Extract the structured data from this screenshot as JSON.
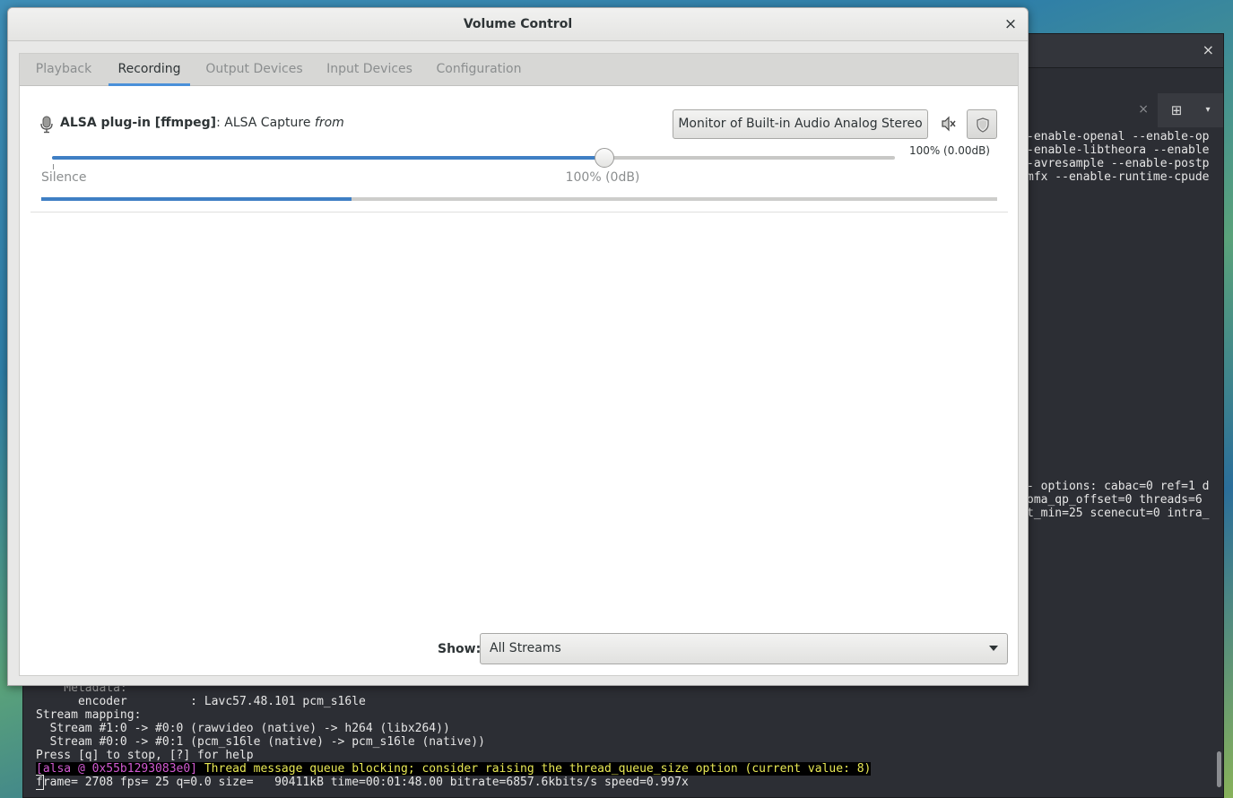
{
  "terminal": {
    "close_label": "×",
    "newtab_label": "⊞",
    "tab_close_label": "×",
    "menu_label": "▾",
    "top_lines": [
      "-enable-openal --enable-op",
      "-enable-libtheora --enable",
      "-avresample --enable-postp",
      "mfx --enable-runtime-cpude"
    ],
    "mid_lines": [
      "- options: cabac=0 ref=1 d",
      "oma_qp_offset=0 threads=6 ",
      "t_min=25 scenecut=0 intra_"
    ],
    "bottom_lines": [
      "    Metadata:",
      "      encoder         : Lavc57.48.101 pcm_s16le",
      "Stream mapping:",
      "  Stream #1:0 -> #0:0 (rawvideo (native) -> h264 (libx264))",
      "  Stream #0:0 -> #0:1 (pcm_s16le (native) -> pcm_s16le (native))",
      "Press [q] to stop, [?] for help"
    ],
    "warning_addr": "[alsa @ 0x55b1293083e0]",
    "warning_msg": " Thread message queue blocking; consider raising the thread_queue_size option (current value: 8)",
    "progress_cursor": "f",
    "progress_line": "rame= 2708 fps= 25 q=0.0 size=   90411kB time=00:01:48.00 bitrate=6857.6kbits/s speed=0.997x"
  },
  "dialog": {
    "title": "Volume Control",
    "close_label": "×",
    "tabs": [
      {
        "label": "Playback"
      },
      {
        "label": "Recording"
      },
      {
        "label": "Output Devices"
      },
      {
        "label": "Input Devices"
      },
      {
        "label": "Configuration"
      }
    ],
    "active_tab": "Recording",
    "stream": {
      "name": "ALSA plug-in [ffmpeg]",
      "separator": ": ",
      "description": "ALSA Capture ",
      "from_label": "from",
      "device_button_label": "Monitor of Built-in Audio Analog Stereo",
      "volume_readout": "100% (0.00dB)",
      "volume_fraction": 0.655,
      "peak_fraction": 0.325,
      "scale_min_label": "Silence",
      "scale_mark_label": "100% (0dB)",
      "icons": [
        "microphone-icon",
        "speaker-mute-icon",
        "lock-shield-icon"
      ]
    },
    "show_label": "Show:",
    "show_value": "All Streams",
    "colors": {
      "accent": "#4a90d9",
      "fill": "#3f7fc4"
    }
  }
}
